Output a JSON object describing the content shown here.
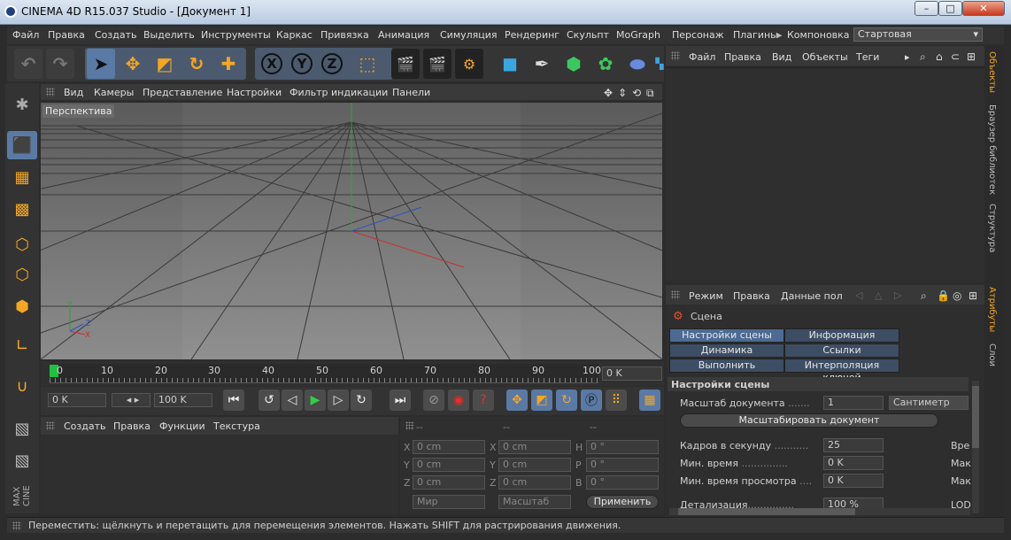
{
  "window": {
    "title": "CINEMA 4D R15.037 Studio - [Документ 1]",
    "min": "–",
    "max": "□",
    "close": "✕"
  },
  "menu": {
    "items": [
      "Файл",
      "Правка",
      "Создать",
      "Выделить",
      "Инструменты",
      "Каркас",
      "Привязка",
      "Анимация",
      "Симуляция",
      "Рендеринг",
      "Скульпт",
      "MoGraph",
      "Персонаж",
      "Плагины",
      "Компоновка"
    ],
    "layout": "Стартовая"
  },
  "viewport": {
    "menu": [
      "Вид",
      "Камеры",
      "Представление",
      "Настройки",
      "Фильтр индикации",
      "Панели"
    ],
    "label": "Перспектива"
  },
  "timeline": {
    "ticks": [
      "0",
      "10",
      "20",
      "30",
      "40",
      "50",
      "60",
      "70",
      "80",
      "90",
      "100"
    ],
    "end": "0 K"
  },
  "transport": {
    "start": "0 K",
    "end": "100 K"
  },
  "material": {
    "menu": [
      "Создать",
      "Правка",
      "Функции",
      "Текстура"
    ]
  },
  "coords": {
    "headers": [
      "--",
      "--",
      "--"
    ],
    "rows": [
      {
        "a": "X",
        "av": "0 cm",
        "b": "X",
        "bv": "0 cm",
        "c": "H",
        "cv": "0 °"
      },
      {
        "a": "Y",
        "av": "0 cm",
        "b": "Y",
        "bv": "0 cm",
        "c": "P",
        "cv": "0 °"
      },
      {
        "a": "Z",
        "av": "0 cm",
        "b": "Z",
        "bv": "0 cm",
        "c": "B",
        "cv": "0 °"
      }
    ],
    "world": "Мир",
    "scale": "Масштаб",
    "apply": "Применить"
  },
  "objects": {
    "menu": [
      "Файл",
      "Правка",
      "Вид",
      "Объекты",
      "Теги"
    ]
  },
  "attributes": {
    "menu": [
      "Режим",
      "Правка",
      "Данные пол"
    ],
    "scene": "Сцена",
    "tabs": [
      "Настройки сцены",
      "Информация",
      "Динамика",
      "Ссылки",
      "Выполнить",
      "Интерполяция ключей"
    ],
    "section": "Настройки сцены",
    "doc_scale_label": "Масштаб документа",
    "doc_scale": "1",
    "unit": "Сантиметр",
    "scale_btn": "Масштабировать документ",
    "fps_label": "Кадров в секунду",
    "fps": "25",
    "min_time_label": "Мин. время",
    "min_time": "0 K",
    "min_preview_label": "Мин. время просмотра",
    "min_preview": "0 K",
    "detail_label": "Детализация",
    "detail": "100 %",
    "right_labels": [
      "Вре",
      "Мак",
      "Мак",
      "LOD"
    ]
  },
  "sidetabs": [
    "Объекты",
    "Браузер библиотек",
    "Структура",
    "Атрибуты",
    "Слои"
  ],
  "status": "Переместить: щёлкнуть и перетащить для перемещения элементов. Нажать SHIFT для растрирования движения.",
  "icons": {
    "xyz": [
      "X",
      "Y",
      "Z"
    ]
  },
  "colors": {
    "accent": "#f5a623",
    "selected": "#4c6a93",
    "axis_x": "#c83030",
    "axis_y": "#30a030",
    "axis_z": "#3050c8"
  }
}
